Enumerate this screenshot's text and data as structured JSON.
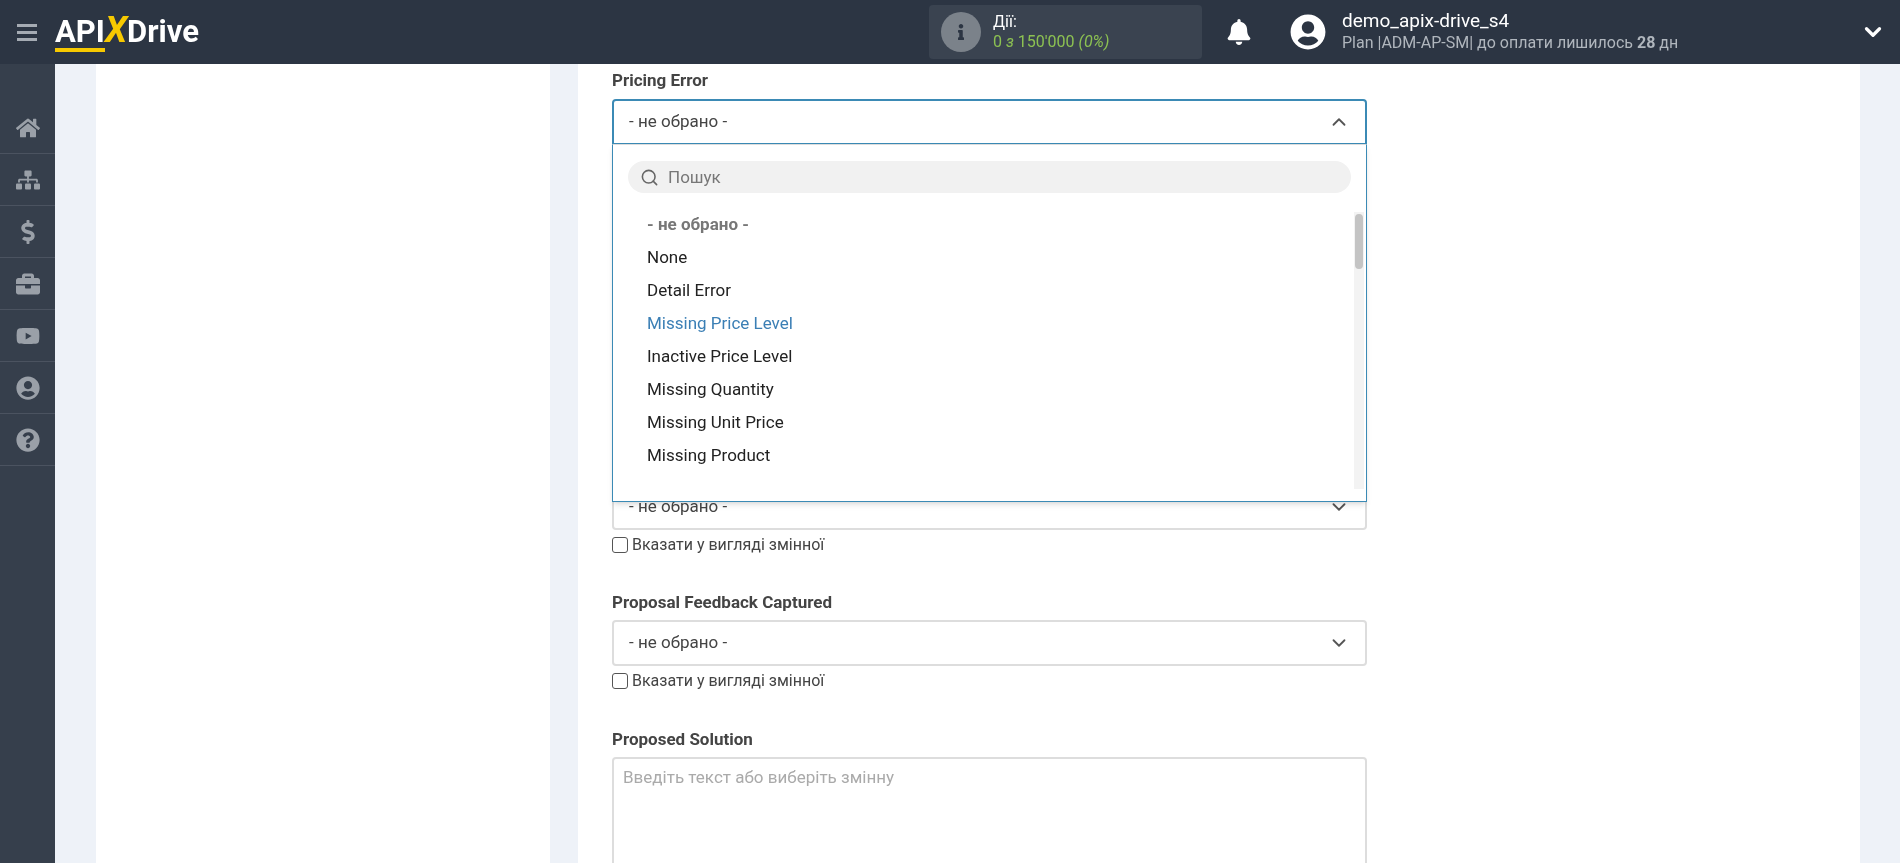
{
  "header": {
    "logo": {
      "left": "API",
      "mark": "X",
      "right": "Drive"
    },
    "actions": {
      "label": "Дії:",
      "value": "0 *з* 150'000 *(0%)*"
    },
    "user": {
      "name": "demo_apix-drive_s4",
      "plan": "Plan |ADM-AP-SM| до оплати лишилось **28** дн"
    }
  },
  "sidebar": {
    "items": [
      {
        "kind": "home"
      },
      {
        "kind": "sitemap"
      },
      {
        "kind": "dollar"
      },
      {
        "kind": "briefcase"
      },
      {
        "kind": "video"
      },
      {
        "kind": "user"
      },
      {
        "kind": "help"
      }
    ]
  },
  "fields": [
    {
      "label": "Pricing Error",
      "value": "- не обрано -",
      "open": true,
      "dropdown": {
        "search_placeholder": "Пошук",
        "options": [
          {
            "label": "- не обрано -",
            "kind": "placeholder",
            "selected": false
          },
          {
            "label": "None",
            "kind": "option",
            "selected": false
          },
          {
            "label": "Detail Error",
            "kind": "option",
            "selected": false
          },
          {
            "label": "Missing Price Level",
            "kind": "option",
            "selected": true
          },
          {
            "label": "Inactive Price Level",
            "kind": "option",
            "selected": false
          },
          {
            "label": "Missing Quantity",
            "kind": "option",
            "selected": false
          },
          {
            "label": "Missing Unit Price",
            "kind": "option",
            "selected": false
          },
          {
            "label": "Missing Product",
            "kind": "option",
            "selected": false
          }
        ]
      }
    },
    {
      "value": "- не обрано -",
      "open": false,
      "variable_checkbox": {
        "label": "Вказати у вигляді змінної",
        "checked": false
      }
    },
    {
      "label": "Proposal Feedback Captured",
      "value": "- не обрано -",
      "open": false,
      "variable_checkbox": {
        "label": "Вказати у вигляді змінної",
        "checked": false
      }
    }
  ],
  "text_field": {
    "label": "Proposed Solution",
    "placeholder": "Введіть текст або виберіть змінну"
  }
}
